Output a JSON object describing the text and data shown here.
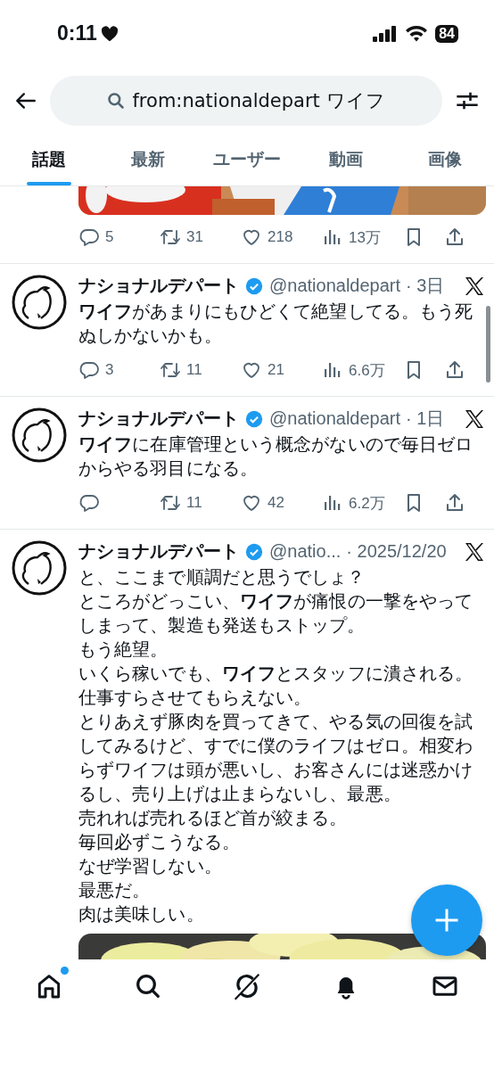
{
  "status_bar": {
    "time": "0:11",
    "battery": "84"
  },
  "search": {
    "value": "from:nationaldepart ワイフ"
  },
  "tabs": [
    {
      "label": "話題",
      "selected": true
    },
    {
      "label": "最新",
      "selected": false
    },
    {
      "label": "ユーザー",
      "selected": false
    },
    {
      "label": "動画",
      "selected": false
    },
    {
      "label": "画像",
      "selected": false
    }
  ],
  "posts": [
    {
      "kind": "partial",
      "replies": "5",
      "reposts": "31",
      "likes": "218",
      "views": "13万"
    },
    {
      "kind": "full",
      "name": "ナショナルデパート",
      "verified": true,
      "handle": "@nationaldepart",
      "time": "· 3日",
      "text": [
        "**ワイフ**があまりにもひどくて絶望してる。もう死ぬしかないかも。"
      ],
      "replies": "3",
      "reposts": "11",
      "likes": "21",
      "views": "6.6万"
    },
    {
      "kind": "full",
      "name": "ナショナルデパート",
      "verified": true,
      "handle": "@nationaldepart",
      "time": "· 1日",
      "text": [
        "**ワイフ**に在庫管理という概念がないので毎日ゼロからやる羽目になる。"
      ],
      "reposts": "11",
      "likes": "42",
      "views": "6.2万"
    },
    {
      "kind": "full",
      "name": "ナショナルデパート",
      "verified": true,
      "handle": "@natio...",
      "time": "· 2025/12/20",
      "text": [
        "と、ここまで順調だと思うでしょ？",
        "ところがどっこい、**ワイフ**が痛恨の一撃をやってしまって、製造も発送もストップ。",
        "もう絶望。",
        "いくら稼いでも、**ワイフ**とスタッフに潰される。",
        "仕事すらさせてもらえない。",
        "とりあえず豚肉を買ってきて、やる気の回復を試してみるけど、すでに僕のライフはゼロ。相変わらずワイフは頭が悪いし、お客さんには迷惑かけるし、売り上げは止まらないし、最悪。",
        "売れれば売れるほど首が絞まる。",
        "毎回必ずこうなる。",
        "なぜ学習しない。",
        "最悪だ。",
        "肉は美味しい。"
      ]
    }
  ],
  "nav": [
    {
      "kind": "home",
      "badge": true
    },
    {
      "kind": "search",
      "badge": false
    },
    {
      "kind": "grok",
      "badge": false
    },
    {
      "kind": "bell",
      "badge": false
    },
    {
      "kind": "mail",
      "badge": false
    }
  ]
}
